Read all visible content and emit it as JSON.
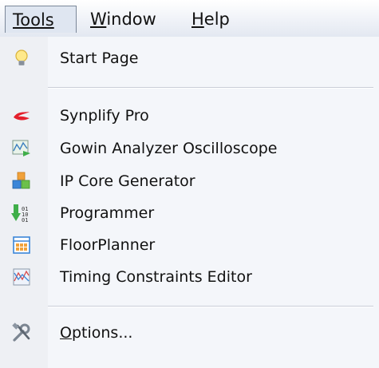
{
  "menubar": {
    "items": [
      {
        "label": "Tools",
        "accel": "T",
        "active": true
      },
      {
        "label": "Window",
        "accel": "W",
        "active": false
      },
      {
        "label": "Help",
        "accel": "H",
        "active": false
      }
    ]
  },
  "menu": {
    "items": [
      {
        "label": "Start Page",
        "icon": "lightbulb-icon"
      },
      {
        "label": "Synplify Pro",
        "icon": "synplify-logo-icon"
      },
      {
        "label": "Gowin Analyzer Oscilloscope",
        "icon": "oscilloscope-icon"
      },
      {
        "label": "IP Core Generator",
        "icon": "ip-core-cubes-icon"
      },
      {
        "label": "Programmer",
        "icon": "programmer-download-icon"
      },
      {
        "label": "FloorPlanner",
        "icon": "floorplanner-grid-icon"
      },
      {
        "label": "Timing Constraints Editor",
        "icon": "timing-chart-icon"
      },
      {
        "label": "Options...",
        "icon": "tools-wrench-icon"
      }
    ]
  },
  "colors": {
    "accent": "#e4202c",
    "menubar_bg": "#e3e8f1",
    "menu_bg": "#f4f6fa"
  }
}
